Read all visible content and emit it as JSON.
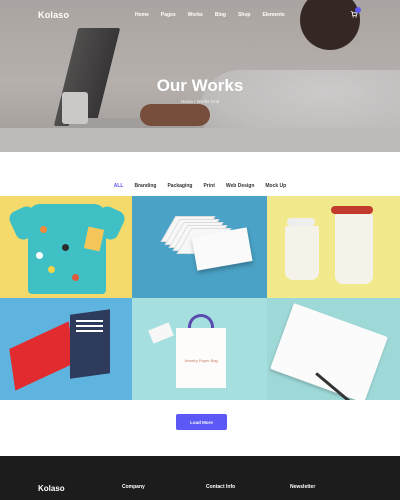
{
  "header": {
    "logo": "Kolaso",
    "menu": [
      "Home",
      "Pages",
      "Works",
      "Blog",
      "Shop",
      "Elements"
    ],
    "cart_count": "0"
  },
  "hero": {
    "title": "Our Works",
    "breadcrumb": "Home  /  Works Grid"
  },
  "filters": {
    "items": [
      "ALL",
      "Branding",
      "Packaging",
      "Print",
      "Web Design",
      "Mock Up"
    ],
    "active": "ALL"
  },
  "gallery": {
    "tiles": [
      {
        "name": "kids-tshirt-mockup",
        "color": "#f3da6b"
      },
      {
        "name": "business-cards-mockup",
        "color": "#4aa2c6"
      },
      {
        "name": "coffee-cups-mockup",
        "color": "#f2e98c"
      },
      {
        "name": "paperback-book-mockup",
        "color": "#5fb3df"
      },
      {
        "name": "paper-bag-mockup",
        "color": "#a6dfe0"
      },
      {
        "name": "notebook-mockup",
        "color": "#9ed9d8"
      }
    ],
    "book_cover_text": "Paperback Book Mockup",
    "bag_text": "Jewelry Paper Bag"
  },
  "load_more_label": "Load More",
  "footer": {
    "logo": "Kolaso",
    "columns": [
      "Company",
      "Contact Info",
      "Newsletter"
    ]
  },
  "colors": {
    "accent": "#5b58f5",
    "footer_bg": "#1c1c1c"
  }
}
